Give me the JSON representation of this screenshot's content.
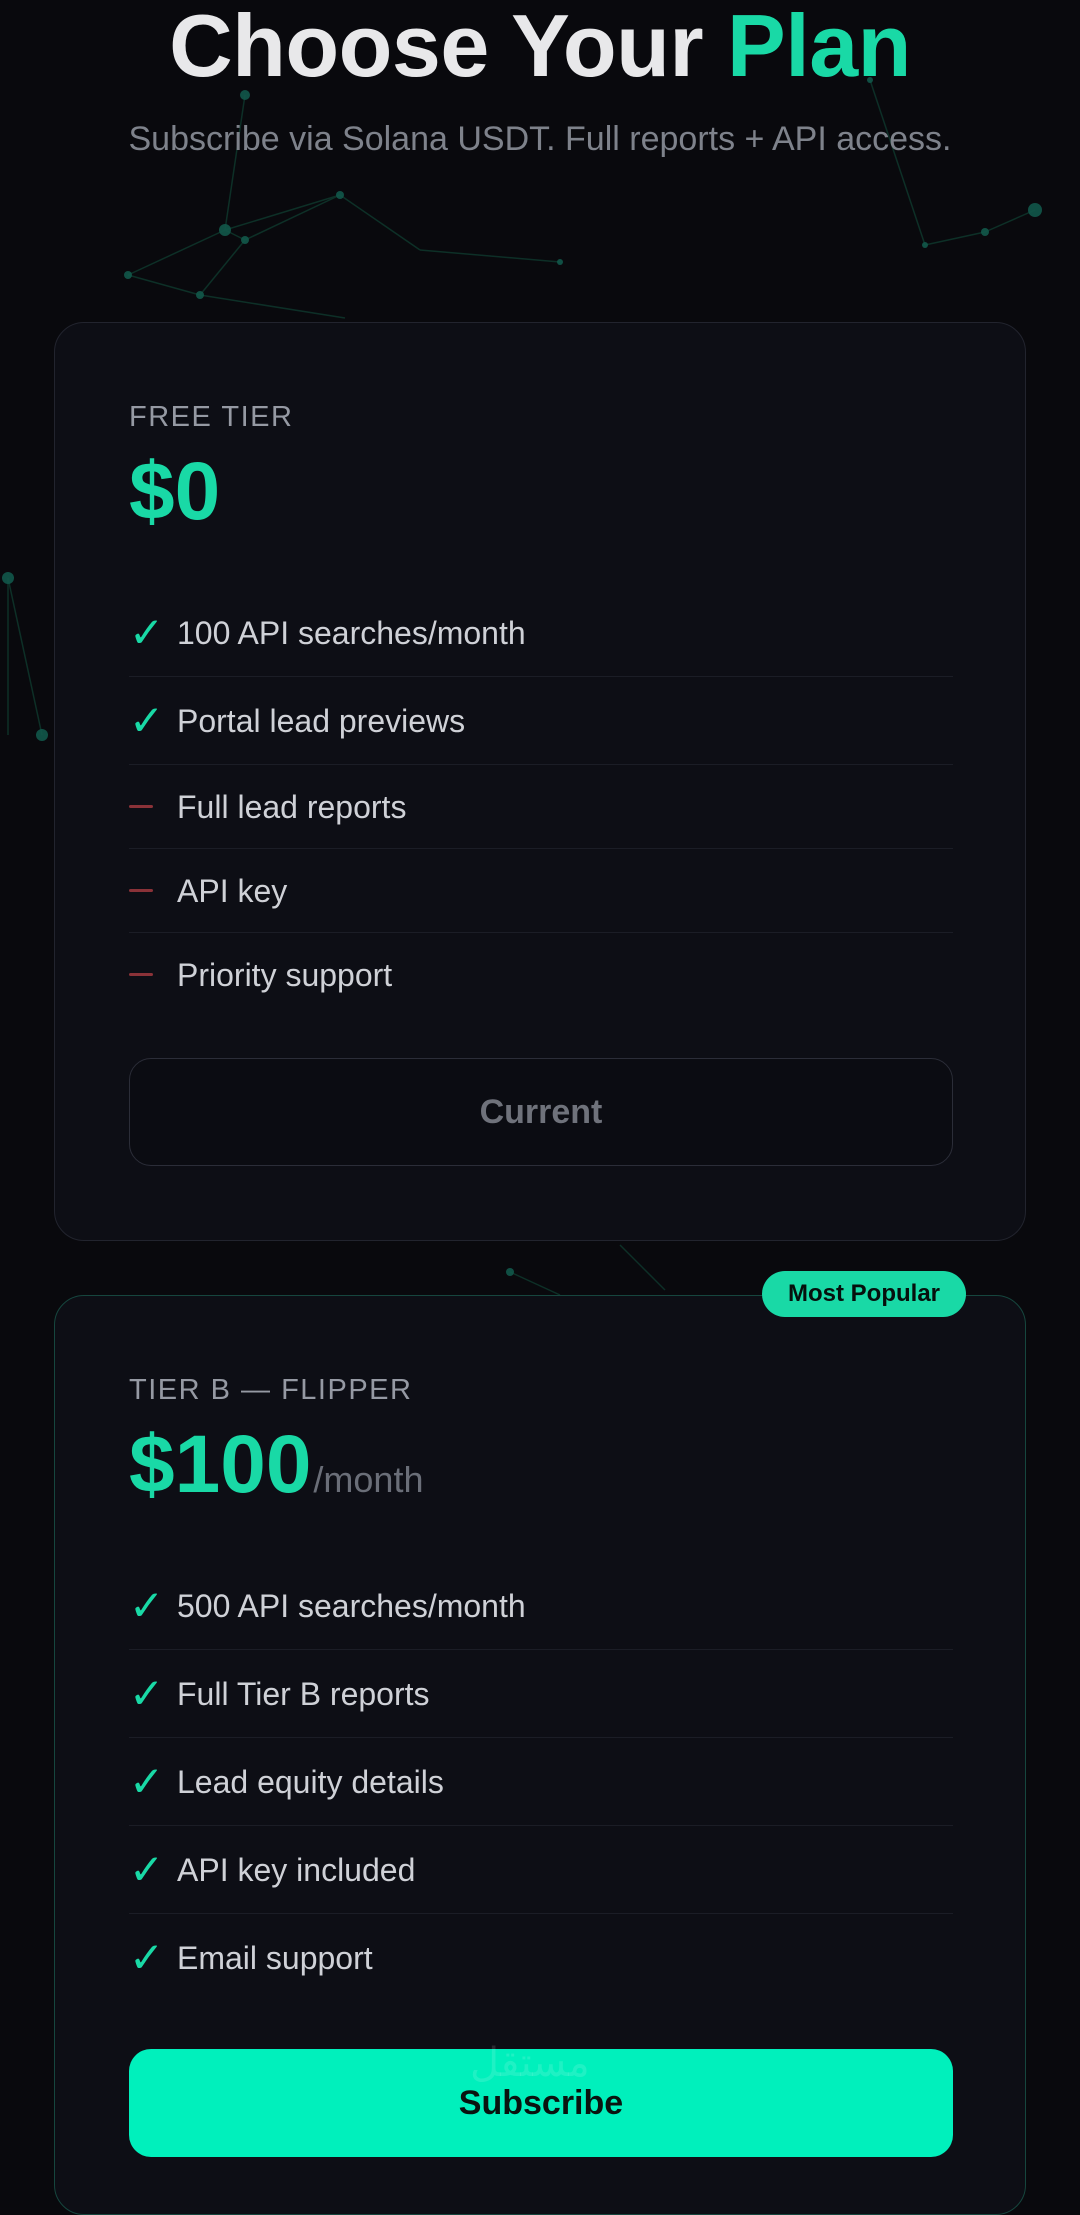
{
  "header": {
    "title_main": "Choose Your",
    "title_accent": "Plan",
    "subtitle": "Subscribe via Solana USDT. Full reports + API access."
  },
  "plans": [
    {
      "label": "FREE TIER",
      "price": "$0",
      "period": "",
      "features": [
        {
          "text": "100 API searches/month",
          "included": true,
          "icon": "check-icon"
        },
        {
          "text": "Portal lead previews",
          "included": true,
          "icon": "check-icon"
        },
        {
          "text": "Full lead reports",
          "included": false,
          "icon": "dash-icon"
        },
        {
          "text": "API key",
          "included": false,
          "icon": "dash-icon"
        },
        {
          "text": "Priority support",
          "included": false,
          "icon": "dash-icon"
        }
      ],
      "button_label": "Current"
    },
    {
      "label": "TIER B — FLIPPER",
      "badge": "Most Popular",
      "price": "$100",
      "period": "/month",
      "features": [
        {
          "text": "500 API searches/month",
          "included": true,
          "icon": "check-icon"
        },
        {
          "text": "Full Tier B reports",
          "included": true,
          "icon": "check-icon"
        },
        {
          "text": "Lead equity details",
          "included": true,
          "icon": "check-icon"
        },
        {
          "text": "API key included",
          "included": true,
          "icon": "check-icon"
        },
        {
          "text": "Email support",
          "included": true,
          "icon": "check-icon"
        }
      ],
      "button_label": "Subscribe"
    }
  ],
  "icons": {
    "check": "✓"
  },
  "watermark": "مستقل",
  "colors": {
    "accent": "#19d9a6",
    "button_primary": "#00f0bc",
    "background": "#09090d",
    "card": "#0d0e15",
    "dash": "#8a3238"
  }
}
